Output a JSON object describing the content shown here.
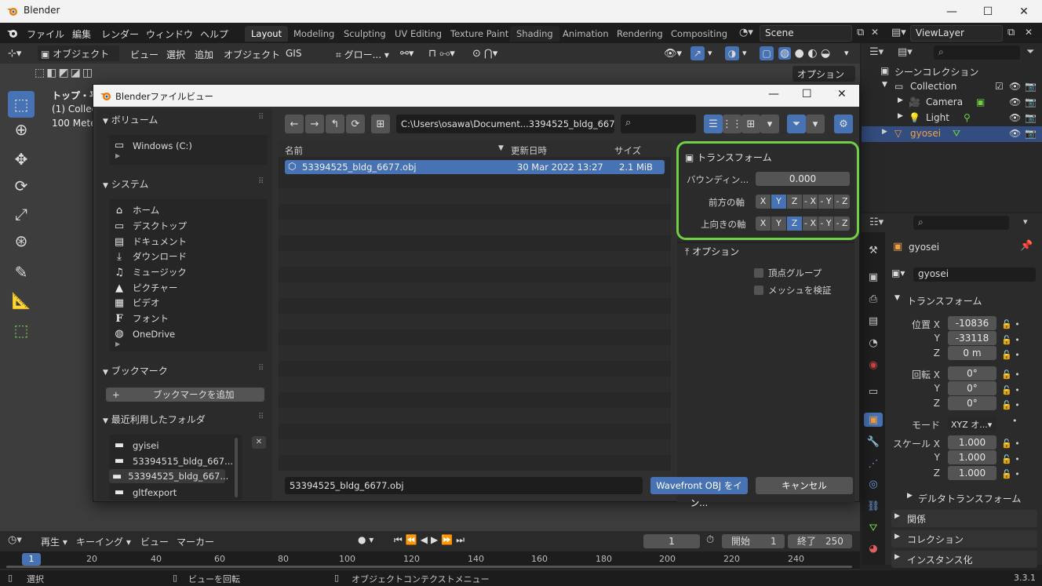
{
  "window": {
    "title": "Blender",
    "minimize": "—",
    "maximize": "☐",
    "close": "✕"
  },
  "topbar": {
    "menus": [
      "ファイル",
      "編集",
      "レンダー",
      "ウィンドウ",
      "ヘルプ"
    ],
    "workspaces": [
      "Layout",
      "Modeling",
      "Sculpting",
      "UV Editing",
      "Texture Paint",
      "Shading",
      "Animation",
      "Rendering",
      "Compositing"
    ],
    "active_workspace": "Layout",
    "scene": "Scene",
    "view_layer": "ViewLayer"
  },
  "viewport_header": {
    "mode": "オブジェクト",
    "menus": [
      "ビュー",
      "選択",
      "追加",
      "オブジェクト",
      "GIS"
    ],
    "transform_orientation": "グロー...",
    "options": "オプション"
  },
  "viewport": {
    "overlay_line1": "トップ・平",
    "overlay_line2": "(1) Collect",
    "overlay_line3": "100 Meter"
  },
  "dialog": {
    "title": "Blenderファイルビュー",
    "path": "C:\\Users\\osawa\\Document...3394525_bldg_6677_obj\\",
    "volumes": {
      "header": "ボリューム",
      "items": [
        "Windows (C:)"
      ]
    },
    "system": {
      "header": "システム",
      "items": [
        {
          "icon": "home-icon",
          "glyph": "⌂",
          "label": "ホーム"
        },
        {
          "icon": "desktop-icon",
          "glyph": "▭",
          "label": "デスクトップ"
        },
        {
          "icon": "documents-icon",
          "glyph": "▤",
          "label": "ドキュメント"
        },
        {
          "icon": "download-icon",
          "glyph": "⤓",
          "label": "ダウンロード"
        },
        {
          "icon": "music-icon",
          "glyph": "♫",
          "label": "ミュージック"
        },
        {
          "icon": "pictures-icon",
          "glyph": "▲",
          "label": "ピクチャー"
        },
        {
          "icon": "video-icon",
          "glyph": "▦",
          "label": "ビデオ"
        },
        {
          "icon": "font-icon",
          "glyph": "F",
          "label": "フォント"
        },
        {
          "icon": "onedrive-icon",
          "glyph": "◍",
          "label": "OneDrive"
        }
      ]
    },
    "bookmarks": {
      "header": "ブックマーク",
      "add_label": "ブックマークを追加"
    },
    "recent": {
      "header": "最近利用したフォルダ",
      "items": [
        "gyisei",
        "53394515_bldg_667...",
        "53394525_bldg_667...",
        "gltfexport"
      ],
      "selected_index": 2
    },
    "file_list": {
      "columns": {
        "name": "名前",
        "modified": "更新日時",
        "size": "サイズ"
      },
      "files": [
        {
          "name": "53394525_bldg_6677.obj",
          "modified": "30 Mar 2022 13:27",
          "size": "2.1 MiB"
        }
      ]
    },
    "options_panel": {
      "transform_header": "トランスフォーム",
      "bounding_label": "バウンディン...",
      "bounding_value": "0.000",
      "forward_label": "前方の軸",
      "up_label": "上向きの軸",
      "axis_options": [
        "X",
        "Y",
        "Z",
        "- X",
        "- Y",
        "- Z"
      ],
      "forward_selected": "Y",
      "up_selected": "Z",
      "options_header": "オプション",
      "vertex_groups_label": "頂点グループ",
      "validate_mesh_label": "メッシュを検証"
    },
    "filename": "53394525_bldg_6677.obj",
    "import_button": "Wavefront OBJ をイン...",
    "cancel_button": "キャンセル"
  },
  "outliner": {
    "scene_collection": "シーンコレクション",
    "items": [
      {
        "name": "Collection",
        "icon": "collection-icon"
      },
      {
        "name": "Camera",
        "icon": "camera-icon"
      },
      {
        "name": "Light",
        "icon": "light-icon"
      },
      {
        "name": "gyosei",
        "icon": "mesh-icon"
      }
    ]
  },
  "properties": {
    "object_name": "gyosei",
    "object_field": "gyosei",
    "transform_header": "トランスフォーム",
    "location_label": "位置 X",
    "location": [
      "-10836",
      "-33118",
      "0 m"
    ],
    "rotation_label": "回転 X",
    "rotation": [
      "0°",
      "0°",
      "0°"
    ],
    "mode_label": "モード",
    "mode_value": "XYZ オ...",
    "scale_label": "スケール X",
    "scale": [
      "1.000",
      "1.000",
      "1.000"
    ],
    "axis_y": "Y",
    "axis_z": "Z",
    "sections": [
      "デルタトランスフォーム",
      "関係",
      "コレクション",
      "インスタンス化"
    ]
  },
  "timeline": {
    "menus": [
      "再生",
      "キーイング",
      "ビュー",
      "マーカー"
    ],
    "current_frame": "1",
    "start_label": "開始",
    "start": "1",
    "end_label": "終了",
    "end": "250",
    "ticks": [
      "20",
      "40",
      "60",
      "80",
      "100",
      "120",
      "140",
      "160",
      "180",
      "200",
      "220",
      "240"
    ],
    "playhead": "1"
  },
  "statusbar": {
    "select": "選択",
    "rotate_view": "ビューを回転",
    "context_menu": "オブジェクトコンテクストメニュー",
    "version": "3.3.1"
  },
  "colors": {
    "accent": "#4772b3",
    "highlight": "#6fd044",
    "selected_text": "#f0a040"
  }
}
